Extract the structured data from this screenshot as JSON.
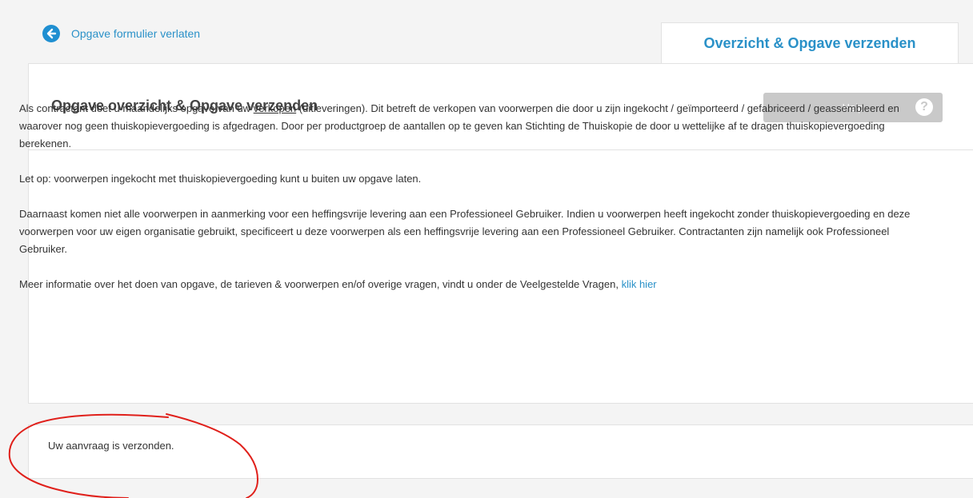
{
  "nav": {
    "back_label": "Opgave formulier verlaten",
    "active_tab": "Overzicht & Opgave verzenden"
  },
  "header": {
    "title": "Opgave overzicht & Opgave verzenden",
    "help_label": "Help",
    "help_icon_glyph": "?"
  },
  "content": {
    "p1_before": "Als contractant doet u maandelijks opgave van uw ",
    "p1_link": "verkopen",
    "p1_after": " (uitleveringen). Dit betreft de verkopen van voorwerpen die door u zijn ingekocht / geïmporteerd / gefabriceerd / geassembleerd en waarover nog geen thuiskopievergoeding is afgedragen. Door per productgroep de aantallen op te geven kan Stichting de Thuiskopie de door u wettelijke af te dragen thuiskopievergoeding berekenen.",
    "p2": "Let op: voorwerpen ingekocht met thuiskopievergoeding kunt u buiten uw opgave laten.",
    "p3": "Daarnaast komen niet alle voorwerpen in aanmerking voor een heffingsvrije levering aan een Professioneel Gebruiker. Indien u voorwerpen heeft ingekocht zonder thuiskopievergoeding en deze voorwerpen voor uw eigen organisatie gebruikt, specificeert u deze voorwerpen als een heffingsvrije levering aan een Professioneel Gebruiker. Contractanten zijn namelijk ook Professioneel Gebruiker.",
    "p4_before": "Meer informatie over het doen van opgave, de tarieven & voorwerpen en/of overige vragen, vindt u onder de Veelgestelde Vragen, ",
    "p4_link": "klik hier"
  },
  "status": {
    "message": "Uw aanvraag is verzonden."
  },
  "colors": {
    "accent": "#2a91c8",
    "annotation": "#e0201b",
    "help_button": "#c9c9c9"
  }
}
